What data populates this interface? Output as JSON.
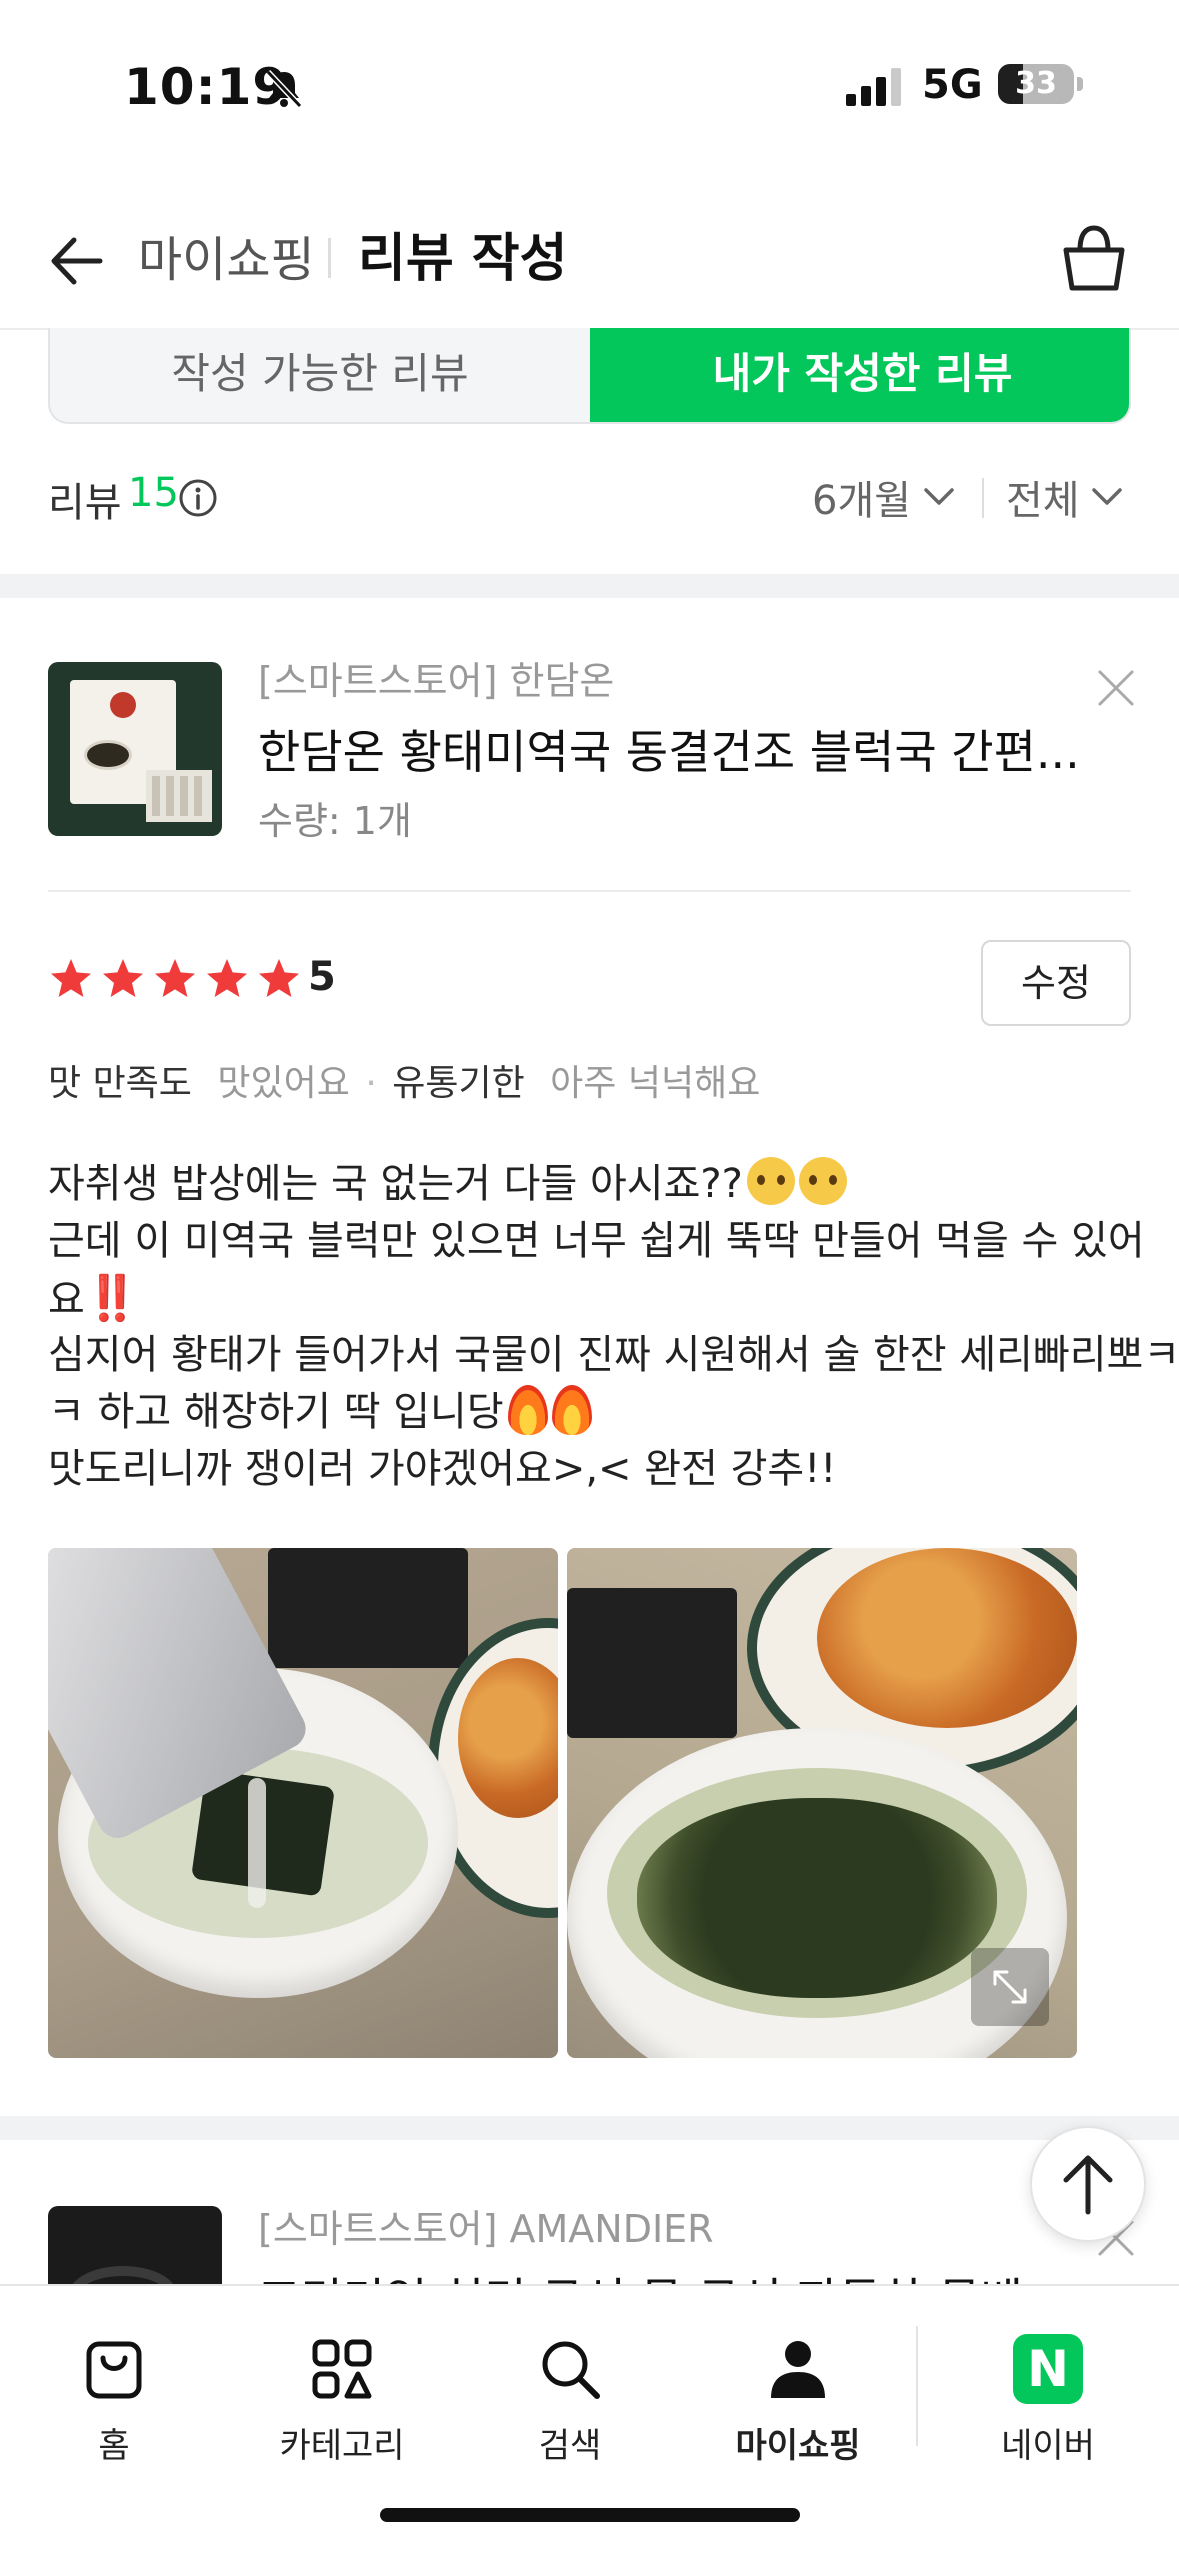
{
  "status_bar": {
    "time": "10:19",
    "network": "5G",
    "battery": "33",
    "battery_level_percent": 33
  },
  "header": {
    "breadcrumb": "마이쇼핑",
    "title": "리뷰 작성",
    "icons": [
      "back-arrow-icon",
      "shopping-bag-icon"
    ]
  },
  "tabs": [
    {
      "label": "작성 가능한 리뷰",
      "active": false
    },
    {
      "label": "내가 작성한 리뷰",
      "active": true
    }
  ],
  "summary": {
    "label": "리뷰",
    "count": "15",
    "filter_period": "6개월",
    "filter_type": "전체"
  },
  "review": {
    "store": "[스마트스토어] 한담온",
    "product_name": "한담온 황태미역국 동결건조 블럭국 간편...",
    "quantity": "수량: 1개",
    "rating": "5",
    "edit_label": "수정",
    "attributes": [
      {
        "key": "맛 만족도",
        "value": "맛있어요"
      },
      {
        "key": "유통기한",
        "value": "아주 넉넉해요"
      }
    ],
    "body": {
      "line1": "자취생 밥상에는 국 없는거 다들 아시죠??",
      "line2": "근데 이 미역국 블럭만 있으면 너무 쉽게 뚝딱 만들어 먹을 수 있어",
      "line3": "요",
      "line4": "심지어 황태가 들어가서 국물이 진짜 시원해서 술 한잔 세리빠리뽀ㅋ.",
      "line5": "ㅋ 하고 해장하기 딱 입니당",
      "line6": "맛도리니까 쟁이러 가야겠어요>,< 완전 강추!!"
    },
    "emoji_bang": "‼️",
    "photo_count": 2
  },
  "next_review": {
    "store": "[스마트스토어] AMANDIER",
    "product_name": "프리미엄 허리 쿠션 목 쿠션 자동차 목베"
  },
  "bottom_nav": {
    "items": [
      {
        "label": "홈",
        "icon": "shopping-bag-icon",
        "active": false
      },
      {
        "label": "카테고리",
        "icon": "category-grid-icon",
        "active": false
      },
      {
        "label": "검색",
        "icon": "search-icon",
        "active": false
      },
      {
        "label": "마이쇼핑",
        "icon": "person-icon",
        "active": true
      },
      {
        "label": "네이버",
        "icon": "naver-n-icon",
        "active": false
      }
    ],
    "naver_letter": "N"
  },
  "colors": {
    "accent_green": "#03c75a",
    "star_red": "#f03b3b",
    "muted_text": "#999999"
  }
}
